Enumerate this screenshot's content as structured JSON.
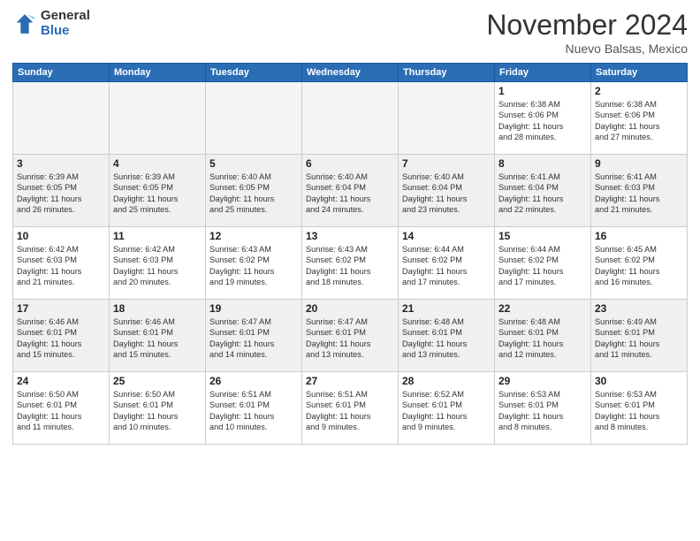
{
  "header": {
    "logo_general": "General",
    "logo_blue": "Blue",
    "month_title": "November 2024",
    "location": "Nuevo Balsas, Mexico"
  },
  "calendar": {
    "days_of_week": [
      "Sunday",
      "Monday",
      "Tuesday",
      "Wednesday",
      "Thursday",
      "Friday",
      "Saturday"
    ],
    "weeks": [
      [
        {
          "day": "",
          "info": ""
        },
        {
          "day": "",
          "info": ""
        },
        {
          "day": "",
          "info": ""
        },
        {
          "day": "",
          "info": ""
        },
        {
          "day": "",
          "info": ""
        },
        {
          "day": "1",
          "info": "Sunrise: 6:38 AM\nSunset: 6:06 PM\nDaylight: 11 hours\nand 28 minutes."
        },
        {
          "day": "2",
          "info": "Sunrise: 6:38 AM\nSunset: 6:06 PM\nDaylight: 11 hours\nand 27 minutes."
        }
      ],
      [
        {
          "day": "3",
          "info": "Sunrise: 6:39 AM\nSunset: 6:05 PM\nDaylight: 11 hours\nand 26 minutes."
        },
        {
          "day": "4",
          "info": "Sunrise: 6:39 AM\nSunset: 6:05 PM\nDaylight: 11 hours\nand 25 minutes."
        },
        {
          "day": "5",
          "info": "Sunrise: 6:40 AM\nSunset: 6:05 PM\nDaylight: 11 hours\nand 25 minutes."
        },
        {
          "day": "6",
          "info": "Sunrise: 6:40 AM\nSunset: 6:04 PM\nDaylight: 11 hours\nand 24 minutes."
        },
        {
          "day": "7",
          "info": "Sunrise: 6:40 AM\nSunset: 6:04 PM\nDaylight: 11 hours\nand 23 minutes."
        },
        {
          "day": "8",
          "info": "Sunrise: 6:41 AM\nSunset: 6:04 PM\nDaylight: 11 hours\nand 22 minutes."
        },
        {
          "day": "9",
          "info": "Sunrise: 6:41 AM\nSunset: 6:03 PM\nDaylight: 11 hours\nand 21 minutes."
        }
      ],
      [
        {
          "day": "10",
          "info": "Sunrise: 6:42 AM\nSunset: 6:03 PM\nDaylight: 11 hours\nand 21 minutes."
        },
        {
          "day": "11",
          "info": "Sunrise: 6:42 AM\nSunset: 6:03 PM\nDaylight: 11 hours\nand 20 minutes."
        },
        {
          "day": "12",
          "info": "Sunrise: 6:43 AM\nSunset: 6:02 PM\nDaylight: 11 hours\nand 19 minutes."
        },
        {
          "day": "13",
          "info": "Sunrise: 6:43 AM\nSunset: 6:02 PM\nDaylight: 11 hours\nand 18 minutes."
        },
        {
          "day": "14",
          "info": "Sunrise: 6:44 AM\nSunset: 6:02 PM\nDaylight: 11 hours\nand 17 minutes."
        },
        {
          "day": "15",
          "info": "Sunrise: 6:44 AM\nSunset: 6:02 PM\nDaylight: 11 hours\nand 17 minutes."
        },
        {
          "day": "16",
          "info": "Sunrise: 6:45 AM\nSunset: 6:02 PM\nDaylight: 11 hours\nand 16 minutes."
        }
      ],
      [
        {
          "day": "17",
          "info": "Sunrise: 6:46 AM\nSunset: 6:01 PM\nDaylight: 11 hours\nand 15 minutes."
        },
        {
          "day": "18",
          "info": "Sunrise: 6:46 AM\nSunset: 6:01 PM\nDaylight: 11 hours\nand 15 minutes."
        },
        {
          "day": "19",
          "info": "Sunrise: 6:47 AM\nSunset: 6:01 PM\nDaylight: 11 hours\nand 14 minutes."
        },
        {
          "day": "20",
          "info": "Sunrise: 6:47 AM\nSunset: 6:01 PM\nDaylight: 11 hours\nand 13 minutes."
        },
        {
          "day": "21",
          "info": "Sunrise: 6:48 AM\nSunset: 6:01 PM\nDaylight: 11 hours\nand 13 minutes."
        },
        {
          "day": "22",
          "info": "Sunrise: 6:48 AM\nSunset: 6:01 PM\nDaylight: 11 hours\nand 12 minutes."
        },
        {
          "day": "23",
          "info": "Sunrise: 6:49 AM\nSunset: 6:01 PM\nDaylight: 11 hours\nand 11 minutes."
        }
      ],
      [
        {
          "day": "24",
          "info": "Sunrise: 6:50 AM\nSunset: 6:01 PM\nDaylight: 11 hours\nand 11 minutes."
        },
        {
          "day": "25",
          "info": "Sunrise: 6:50 AM\nSunset: 6:01 PM\nDaylight: 11 hours\nand 10 minutes."
        },
        {
          "day": "26",
          "info": "Sunrise: 6:51 AM\nSunset: 6:01 PM\nDaylight: 11 hours\nand 10 minutes."
        },
        {
          "day": "27",
          "info": "Sunrise: 6:51 AM\nSunset: 6:01 PM\nDaylight: 11 hours\nand 9 minutes."
        },
        {
          "day": "28",
          "info": "Sunrise: 6:52 AM\nSunset: 6:01 PM\nDaylight: 11 hours\nand 9 minutes."
        },
        {
          "day": "29",
          "info": "Sunrise: 6:53 AM\nSunset: 6:01 PM\nDaylight: 11 hours\nand 8 minutes."
        },
        {
          "day": "30",
          "info": "Sunrise: 6:53 AM\nSunset: 6:01 PM\nDaylight: 11 hours\nand 8 minutes."
        }
      ]
    ]
  }
}
